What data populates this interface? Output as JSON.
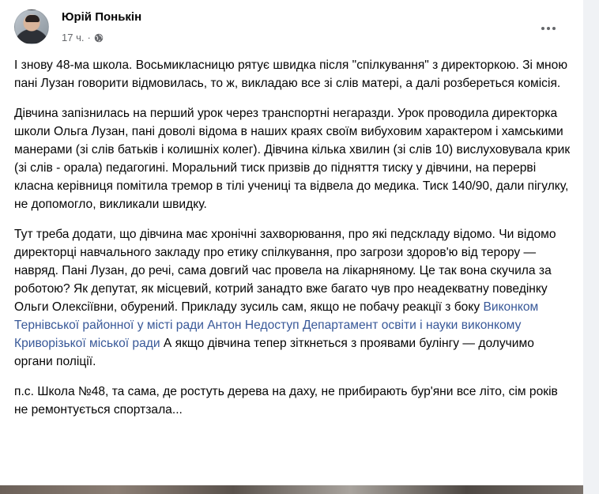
{
  "post": {
    "author": "Юрій Понькін",
    "time": "17 ч.",
    "dot": "·",
    "paragraphs": [
      [
        "І знову 48-ма школа. Восьмикласницю рятує швидка після \"спілкування\" з директоркою. Зі мною пані Лузан говорити відмовилась, то ж, викладаю все зі слів матері, а далі розбереться комісія."
      ],
      [
        "Дівчина запізнилась на перший урок через транспортні негаразди. Урок проводила директорка школи Ольга Лузан, пані доволі відома в наших краях своїм вибуховим характером і хамськими манерами (зі слів батьків і колишніх колег). Дівчина кілька хвилин (зі слів 10) вислуховувала крик (зі слів - орала) педагогині. Моральний тиск призвів до підняття тиску у дівчини, на перерві класна керівниця помітила тремор в тілі учениці та відвела до медика. Тиск 140/90, дали пігулку, не допомогло, викликали швидку."
      ],
      [
        "Тут треба додати, що дівчина має хронічні захворювання, про які педскладу відомо. Чи відомо директорці навчального закладу про етику спілкування, про загрози здоров'ю від терору — навряд. Пані Лузан, до речі, сама довгий час провела на лікарняному. Це так вона скучила за роботою? Як депутат, як місцевий, котрий занадто вже багато чув про неадекватну поведінку Ольги Олексіївни, обурений. Прикладу зусиль сам, якщо не побачу реакції з боку "
      ],
      [
        "п.с. Школа №48, та сама, де ростуть дерева на даху, не прибирають бур'яни все літо, сім років не ремонтується спортзала..."
      ]
    ],
    "links": [
      "Виконком Тернівської районної у місті ради",
      "Антон Недоступ",
      "Департамент освіти і науки виконкому Криворізької міської ради"
    ],
    "link_space_1": " ",
    "link_space_2": " ",
    "after_links": " А якщо дівчина тепер зіткнеться з проявами булінгу — долучимо органи поліції."
  },
  "icons": {
    "privacy": "globe-icon",
    "menu": "more-horizontal-icon"
  },
  "colors": {
    "link": "#385898",
    "text": "#050505",
    "meta": "#65676b"
  }
}
